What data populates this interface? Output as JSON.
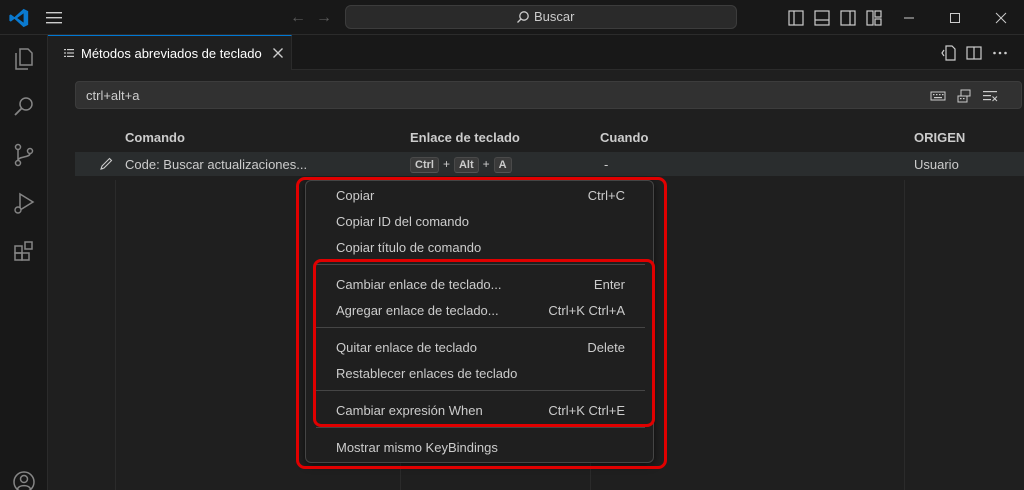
{
  "titlebar": {
    "search_label": "Buscar"
  },
  "tab": {
    "label": "Métodos abreviados de teclado"
  },
  "keybindings": {
    "search_value": "ctrl+alt+a",
    "columns": {
      "command": "Comando",
      "keybinding": "Enlace de teclado",
      "when": "Cuando",
      "source": "ORIGEN"
    },
    "row": {
      "command": "Code: Buscar actualizaciones...",
      "keys": [
        "Ctrl",
        "Alt",
        "A"
      ],
      "plus": "+",
      "when": "-",
      "source": "Usuario"
    }
  },
  "context_menu": {
    "items": [
      {
        "label": "Copiar",
        "shortcut": "Ctrl+C"
      },
      {
        "label": "Copiar ID del comando",
        "shortcut": ""
      },
      {
        "label": "Copiar título de comando",
        "shortcut": ""
      },
      {
        "label": "Cambiar enlace de teclado...",
        "shortcut": "Enter"
      },
      {
        "label": "Agregar enlace de teclado...",
        "shortcut": "Ctrl+K Ctrl+A"
      },
      {
        "label": "Quitar enlace de teclado",
        "shortcut": "Delete"
      },
      {
        "label": "Restablecer enlaces de teclado",
        "shortcut": ""
      },
      {
        "label": "Cambiar expresión When",
        "shortcut": "Ctrl+K Ctrl+E"
      },
      {
        "label": "Mostrar mismo KeyBindings",
        "shortcut": ""
      }
    ]
  },
  "colors": {
    "highlight": "#e00000",
    "accent": "#0078d4",
    "background": "#1f1f1f"
  },
  "icons": [
    "vscode-logo-icon",
    "menu-icon",
    "arrow-left-icon",
    "arrow-right-icon",
    "search-icon",
    "toggle-sidebar-icon",
    "toggle-panel-icon",
    "toggle-secondary-sidebar-icon",
    "customize-layout-icon",
    "minimize-icon",
    "maximize-icon",
    "close-icon",
    "explorer-icon",
    "search-view-icon",
    "source-control-icon",
    "run-debug-icon",
    "extensions-icon",
    "account-icon",
    "keyboard-shortcuts-icon",
    "open-json-icon",
    "split-editor-icon",
    "more-actions-icon",
    "record-keys-icon",
    "sort-by-precedence-icon",
    "clear-search-icon",
    "edit-icon"
  ]
}
